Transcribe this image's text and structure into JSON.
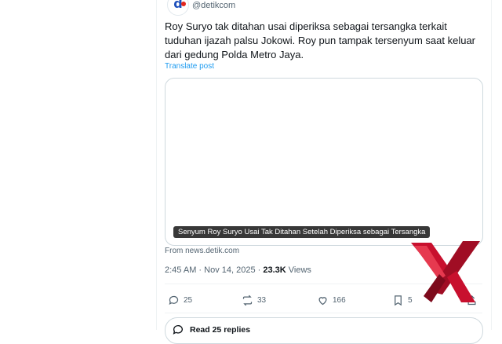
{
  "account": {
    "avatar_letter": "d",
    "handle": "@detikcom"
  },
  "post": {
    "text": "Roy Suryo tak ditahan usai diperiksa sebagai tersangka terkait tuduhan ijazah palsu Jokowi. Roy pun tampak tersenyum saat keluar dari gedung Polda Metro Jaya.",
    "translate_label": "Translate post",
    "card": {
      "caption": "Senyum Roy Suryo Usai Tak Ditahan Setelah Diperiksa sebagai Tersangka",
      "source": "From news.detik.com"
    },
    "timestamp": "2:45 AM · Nov 14, 2025 · ",
    "views_count": "23.3K",
    "views_label": " Views"
  },
  "actions": {
    "replies": "25",
    "reposts": "33",
    "likes": "166",
    "bookmarks": "5"
  },
  "read_replies": {
    "label": "Read 25 replies"
  },
  "colors": {
    "text": "#0f1419",
    "muted": "#536471",
    "link": "#1d9bf0",
    "border": "#cfd9de",
    "watermark_red": "#c8102e"
  },
  "watermark": {
    "icon": "x-shaped-logo-watermark"
  }
}
